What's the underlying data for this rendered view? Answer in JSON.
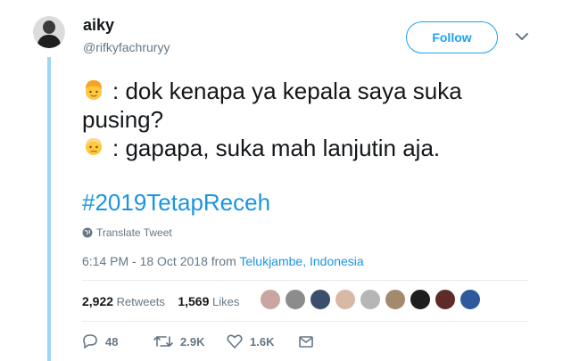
{
  "user": {
    "display_name": "aiky",
    "handle": "@rifkyfachruryy"
  },
  "follow_label": "Follow",
  "tweet": {
    "line1": ": dok kenapa ya kepala saya suka",
    "line2": "pusing?",
    "line3": ": gapapa, suka mah lanjutin aja.",
    "hashtag": "#2019TetapReceh"
  },
  "translate_label": "Translate Tweet",
  "timestamp": {
    "time": "6:14 PM - 18 Oct 2018 from ",
    "location": "Telukjambe, Indonesia"
  },
  "stats": {
    "retweets_count": "2,922",
    "retweets_label": "Retweets",
    "likes_count": "1,569",
    "likes_label": "Likes"
  },
  "actions": {
    "replies": "48",
    "retweets": "2.9K",
    "likes": "1.6K"
  },
  "icons": [
    "chevron-down-icon",
    "globe-icon",
    "reply-icon",
    "retweet-icon",
    "heart-icon",
    "message-icon"
  ],
  "colors": {
    "accent": "#1da1f2",
    "link": "#1b95e0",
    "muted": "#657786",
    "thread": "#9ed6f5"
  }
}
